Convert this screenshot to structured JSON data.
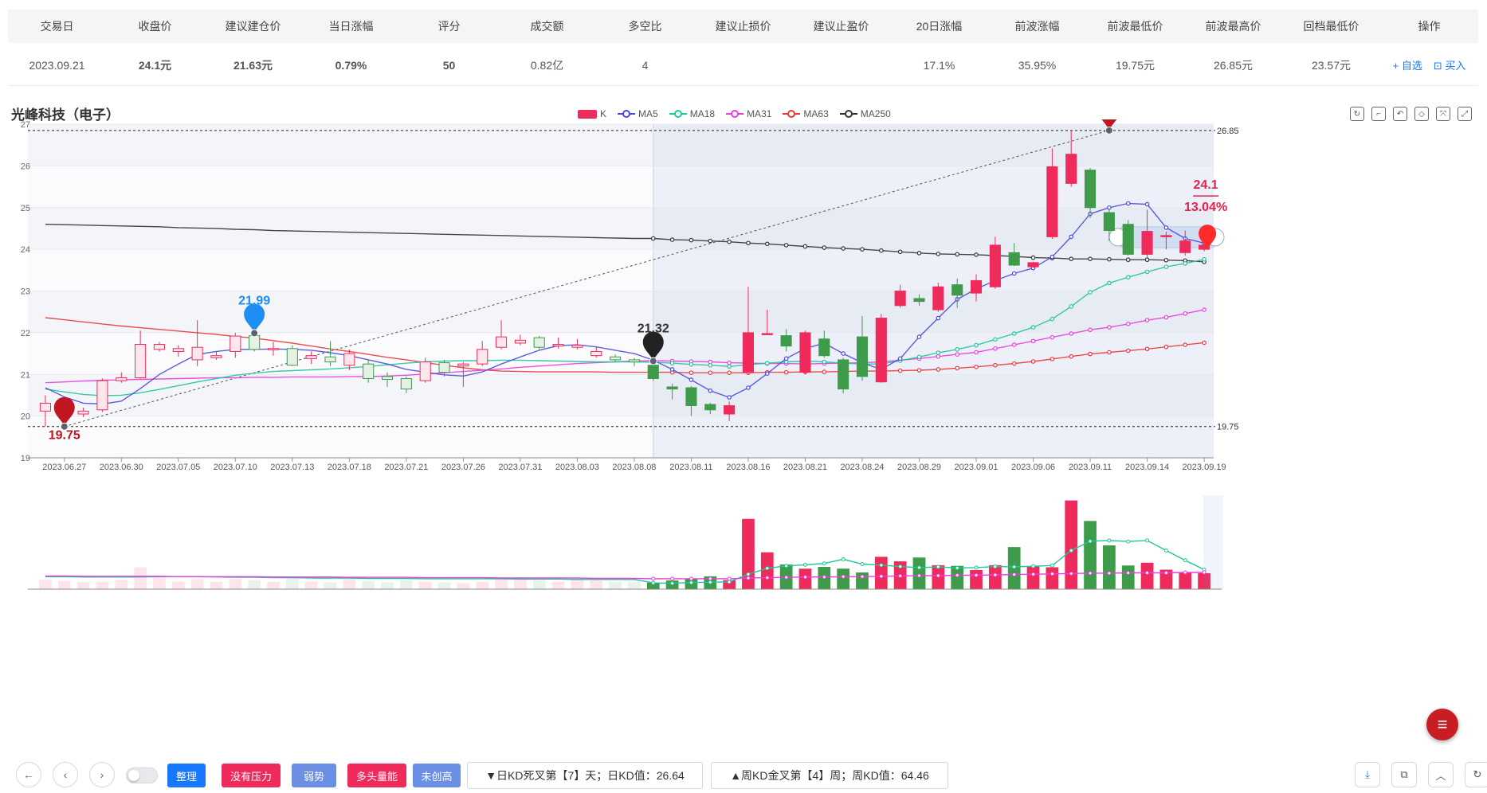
{
  "table": {
    "headers": [
      "交易日",
      "收盘价",
      "建议建仓价",
      "当日涨幅",
      "评分",
      "成交额",
      "多空比",
      "建议止损价",
      "建议止盈价",
      "20日涨幅",
      "前波涨幅",
      "前波最低价",
      "前波最高价",
      "回档最低价",
      "操作"
    ],
    "row": {
      "date": "2023.09.21",
      "close": "24.1元",
      "entry": "21.63元",
      "change": "0.79%",
      "score": "50",
      "turnover": "0.82亿",
      "ratio": "4",
      "stop_loss": "",
      "take_profit": "",
      "chg20": "17.1%",
      "wave_chg": "35.95%",
      "wave_low": "19.75元",
      "wave_high": "26.85元",
      "pullback_low": "23.57元",
      "add_watch": "+ 自选",
      "buy": "⊡ 买入"
    }
  },
  "stock_name": "光峰科技（电子）",
  "legend": [
    "K",
    "MA5",
    "MA18",
    "MA31",
    "MA63",
    "MA250"
  ],
  "colors": {
    "up": "#ef2b5c",
    "down": "#3e9b4a",
    "ma5": "#4b4bd8",
    "ma18": "#1fc79a",
    "ma31": "#ea3ddf",
    "ma63": "#e83a3a",
    "ma250": "#333333"
  },
  "chart_data": {
    "type": "candlestick",
    "ylim": [
      19,
      27
    ],
    "yticks": [
      19,
      20,
      21,
      22,
      23,
      24,
      25,
      26,
      27
    ],
    "xtick_labels": [
      "2023.06.27",
      "2023.06.30",
      "2023.07.05",
      "2023.07.10",
      "2023.07.13",
      "2023.07.18",
      "2023.07.21",
      "2023.07.26",
      "2023.07.31",
      "2023.08.03",
      "2023.08.08",
      "2023.08.11",
      "2023.08.16",
      "2023.08.21",
      "2023.08.24",
      "2023.08.29",
      "2023.09.01",
      "2023.09.06",
      "2023.09.11",
      "2023.09.14",
      "2023.09.19"
    ],
    "zoom_start_index": 32,
    "candles": [
      [
        20.12,
        20.31,
        19.75,
        20.5
      ],
      [
        20.18,
        20.28,
        20.05,
        20.4
      ],
      [
        20.05,
        20.12,
        19.98,
        20.2
      ],
      [
        20.15,
        20.85,
        20.1,
        20.9
      ],
      [
        20.85,
        20.92,
        20.8,
        21.05
      ],
      [
        20.92,
        21.72,
        20.9,
        22.05
      ],
      [
        21.6,
        21.72,
        21.55,
        21.78
      ],
      [
        21.55,
        21.62,
        21.42,
        21.7
      ],
      [
        21.35,
        21.65,
        21.2,
        22.3
      ],
      [
        21.4,
        21.45,
        21.35,
        21.55
      ],
      [
        21.55,
        21.92,
        21.4,
        22.0
      ],
      [
        21.93,
        21.6,
        21.55,
        22.25
      ],
      [
        21.6,
        21.62,
        21.45,
        21.78
      ],
      [
        21.62,
        21.22,
        21.2,
        21.7
      ],
      [
        21.38,
        21.45,
        21.25,
        21.55
      ],
      [
        21.42,
        21.3,
        21.2,
        21.8
      ],
      [
        21.22,
        21.5,
        21.1,
        21.6
      ],
      [
        21.25,
        20.9,
        20.8,
        21.35
      ],
      [
        20.95,
        20.88,
        20.7,
        21.05
      ],
      [
        20.9,
        20.65,
        20.55,
        20.95
      ],
      [
        20.85,
        21.3,
        20.8,
        21.4
      ],
      [
        21.28,
        21.05,
        20.95,
        21.35
      ],
      [
        21.2,
        21.25,
        20.7,
        21.3
      ],
      [
        21.25,
        21.6,
        21.2,
        21.8
      ],
      [
        21.65,
        21.9,
        21.6,
        22.3
      ],
      [
        21.75,
        21.82,
        21.7,
        21.95
      ],
      [
        21.88,
        21.65,
        21.6,
        21.92
      ],
      [
        21.68,
        21.72,
        21.62,
        21.88
      ],
      [
        21.65,
        21.7,
        21.6,
        21.85
      ],
      [
        21.45,
        21.55,
        21.4,
        21.65
      ],
      [
        21.42,
        21.35,
        21.3,
        21.48
      ],
      [
        21.35,
        21.3,
        21.2,
        21.4
      ],
      [
        21.22,
        20.9,
        20.85,
        21.3
      ],
      [
        20.7,
        20.65,
        20.4,
        20.78
      ],
      [
        20.68,
        20.25,
        20.0,
        20.72
      ],
      [
        20.28,
        20.15,
        20.05,
        20.32
      ],
      [
        20.05,
        20.25,
        19.88,
        20.35
      ],
      [
        21.05,
        22.0,
        21.0,
        23.1
      ],
      [
        21.98,
        21.98,
        21.95,
        22.55
      ],
      [
        21.93,
        21.68,
        21.55,
        22.08
      ],
      [
        21.05,
        22.0,
        21.0,
        22.05
      ],
      [
        21.85,
        21.45,
        21.4,
        22.05
      ],
      [
        21.35,
        20.65,
        20.55,
        21.4
      ],
      [
        21.9,
        20.95,
        20.85,
        22.4
      ],
      [
        20.82,
        22.35,
        20.8,
        22.45
      ],
      [
        22.65,
        23.0,
        22.6,
        23.15
      ],
      [
        22.82,
        22.75,
        22.65,
        22.92
      ],
      [
        22.55,
        23.1,
        22.5,
        23.2
      ],
      [
        23.15,
        22.9,
        22.6,
        23.3
      ],
      [
        22.95,
        23.25,
        22.75,
        23.4
      ],
      [
        23.1,
        24.1,
        23.05,
        24.3
      ],
      [
        23.92,
        23.62,
        23.6,
        24.15
      ],
      [
        23.58,
        23.68,
        23.55,
        23.7
      ],
      [
        24.3,
        25.98,
        24.25,
        26.42
      ],
      [
        25.58,
        26.28,
        25.5,
        26.85
      ],
      [
        25.9,
        25.0,
        24.75,
        25.95
      ],
      [
        24.88,
        24.45,
        24.2,
        24.95
      ],
      [
        24.6,
        23.88,
        23.85,
        24.7
      ],
      [
        23.88,
        24.43,
        23.8,
        24.95
      ],
      [
        24.3,
        24.33,
        24.0,
        24.42
      ],
      [
        23.92,
        24.2,
        23.85,
        24.45
      ],
      [
        24.0,
        24.1,
        23.95,
        24.2
      ]
    ],
    "ma": {
      "MA5": [
        20.68,
        20.46,
        20.31,
        20.29,
        20.36,
        20.66,
        21.0,
        21.25,
        21.48,
        21.55,
        21.6,
        21.6,
        21.61,
        21.6,
        21.58,
        21.52,
        21.45,
        21.35,
        21.25,
        21.12,
        21.05,
        20.99,
        20.96,
        21.06,
        21.25,
        21.42,
        21.58,
        21.69,
        21.71,
        21.66,
        21.58,
        21.5,
        21.34,
        21.12,
        20.87,
        20.61,
        20.45,
        20.68,
        21.02,
        21.38,
        21.62,
        21.75,
        21.5,
        21.28,
        21.12,
        21.38,
        21.9,
        22.35,
        22.8,
        23.05,
        23.25,
        23.42,
        23.55,
        23.82,
        24.3,
        24.85,
        25.0,
        25.1,
        25.08,
        24.52,
        24.26,
        24.15
      ],
      "MA18": [
        20.65,
        20.58,
        20.52,
        20.49,
        20.5,
        20.56,
        20.64,
        20.73,
        20.82,
        20.9,
        20.98,
        21.03,
        21.07,
        21.09,
        21.11,
        21.13,
        21.16,
        21.19,
        21.23,
        21.27,
        21.3,
        21.32,
        21.33,
        21.33,
        21.34,
        21.34,
        21.33,
        21.32,
        21.31,
        21.3,
        21.3,
        21.3,
        21.29,
        21.27,
        21.24,
        21.22,
        21.19,
        21.23,
        21.27,
        21.3,
        21.32,
        21.3,
        21.27,
        21.25,
        21.25,
        21.33,
        21.42,
        21.52,
        21.6,
        21.7,
        21.84,
        21.98,
        22.13,
        22.33,
        22.63,
        22.97,
        23.19,
        23.33,
        23.46,
        23.58,
        23.66,
        23.76
      ],
      "MA31": [
        20.8,
        20.82,
        20.84,
        20.86,
        20.87,
        20.88,
        20.89,
        20.9,
        20.91,
        20.92,
        20.92,
        20.93,
        20.93,
        20.94,
        20.94,
        20.94,
        20.95,
        20.95,
        20.96,
        20.98,
        21.01,
        21.04,
        21.07,
        21.1,
        21.13,
        21.17,
        21.2,
        21.23,
        21.26,
        21.28,
        21.3,
        21.32,
        21.33,
        21.32,
        21.31,
        21.3,
        21.28,
        21.27,
        21.26,
        21.26,
        21.25,
        21.26,
        21.27,
        21.28,
        21.3,
        21.34,
        21.38,
        21.43,
        21.48,
        21.53,
        21.62,
        21.71,
        21.8,
        21.89,
        21.98,
        22.07,
        22.13,
        22.21,
        22.3,
        22.37,
        22.46,
        22.55
      ],
      "MA63": [
        22.36,
        22.31,
        22.26,
        22.21,
        22.16,
        22.12,
        22.08,
        22.04,
        22.0,
        21.96,
        21.91,
        21.87,
        21.81,
        21.75,
        21.68,
        21.61,
        21.55,
        21.48,
        21.41,
        21.35,
        21.28,
        21.22,
        21.16,
        21.11,
        21.08,
        21.07,
        21.06,
        21.06,
        21.06,
        21.06,
        21.05,
        21.05,
        21.05,
        21.05,
        21.04,
        21.04,
        21.04,
        21.04,
        21.05,
        21.05,
        21.06,
        21.06,
        21.07,
        21.08,
        21.08,
        21.09,
        21.1,
        21.12,
        21.15,
        21.18,
        21.22,
        21.26,
        21.31,
        21.37,
        21.43,
        21.49,
        21.53,
        21.57,
        21.61,
        21.66,
        21.71,
        21.76
      ],
      "MA250": [
        24.6,
        24.59,
        24.58,
        24.57,
        24.56,
        24.55,
        24.54,
        24.52,
        24.51,
        24.5,
        24.48,
        24.47,
        24.45,
        24.44,
        24.43,
        24.42,
        24.41,
        24.4,
        24.39,
        24.38,
        24.37,
        24.36,
        24.35,
        24.34,
        24.33,
        24.32,
        24.31,
        24.3,
        24.29,
        24.28,
        24.27,
        24.26,
        24.26,
        24.23,
        24.22,
        24.2,
        24.18,
        24.15,
        24.13,
        24.1,
        24.07,
        24.04,
        24.02,
        24.0,
        23.97,
        23.94,
        23.91,
        23.89,
        23.88,
        23.87,
        23.85,
        23.83,
        23.8,
        23.79,
        23.77,
        23.77,
        23.76,
        23.75,
        23.75,
        23.74,
        23.73,
        23.7
      ]
    },
    "volume": [
      0.28,
      0.24,
      0.2,
      0.22,
      0.26,
      0.63,
      0.4,
      0.22,
      0.28,
      0.21,
      0.3,
      0.26,
      0.21,
      0.31,
      0.22,
      0.2,
      0.3,
      0.24,
      0.2,
      0.26,
      0.22,
      0.2,
      0.17,
      0.21,
      0.3,
      0.34,
      0.26,
      0.22,
      0.29,
      0.25,
      0.21,
      0.2,
      0.19,
      0.25,
      0.3,
      0.37,
      0.26,
      2.02,
      1.06,
      0.71,
      0.59,
      0.64,
      0.59,
      0.48,
      0.93,
      0.8,
      0.91,
      0.69,
      0.67,
      0.55,
      0.69,
      1.21,
      0.66,
      0.63,
      2.55,
      1.96,
      1.26,
      0.68,
      0.76,
      0.56,
      0.47,
      0.46
    ],
    "vol_ma": [
      0.36,
      0.36,
      0.35,
      0.35,
      0.35,
      0.35,
      0.36,
      0.36,
      0.36,
      0.35,
      0.34,
      0.34,
      0.33,
      0.33,
      0.32,
      0.32,
      0.32,
      0.31,
      0.31,
      0.31,
      0.3,
      0.3,
      0.3,
      0.3,
      0.3,
      0.29,
      0.29,
      0.29,
      0.28,
      0.28,
      0.28,
      0.28,
      0.18,
      0.17,
      0.19,
      0.2,
      0.21,
      0.43,
      0.6,
      0.67,
      0.7,
      0.74,
      0.86,
      0.72,
      0.69,
      0.65,
      0.62,
      0.64,
      0.61,
      0.62,
      0.65,
      0.64,
      0.66,
      0.68,
      1.11,
      1.38,
      1.4,
      1.37,
      1.4,
      1.11,
      0.83,
      0.56
    ],
    "vol_ma2": [
      0.38,
      0.38,
      0.37,
      0.37,
      0.37,
      0.37,
      0.37,
      0.36,
      0.36,
      0.36,
      0.36,
      0.36,
      0.35,
      0.35,
      0.35,
      0.35,
      0.34,
      0.34,
      0.34,
      0.34,
      0.33,
      0.33,
      0.33,
      0.33,
      0.32,
      0.32,
      0.32,
      0.32,
      0.32,
      0.31,
      0.31,
      0.31,
      0.3,
      0.3,
      0.3,
      0.3,
      0.3,
      0.32,
      0.33,
      0.34,
      0.35,
      0.35,
      0.36,
      0.36,
      0.37,
      0.38,
      0.39,
      0.39,
      0.4,
      0.4,
      0.41,
      0.42,
      0.43,
      0.44,
      0.45,
      0.46,
      0.46,
      0.47,
      0.47,
      0.47,
      0.48,
      0.48
    ],
    "markers": {
      "low": {
        "index": 1,
        "value": "19.75"
      },
      "mid1": {
        "index": 11,
        "value": "21.99"
      },
      "mid2": {
        "index": 32,
        "value": "21.32"
      },
      "high": {
        "index": 56,
        "value": "26.85"
      },
      "last": {
        "index": 61,
        "value": "24.1",
        "pct": "13.04%"
      }
    },
    "ref_lines": [
      {
        "value": 26.85,
        "label": "26.85"
      },
      {
        "value": 19.75,
        "label": "19.75"
      }
    ]
  },
  "bottom": {
    "tags": [
      "整理",
      "没有压力",
      "弱势",
      "多头量能",
      "未创高"
    ],
    "info1": "▼日KD死叉第【7】天；日KD值：26.64",
    "info2": "▲周KD金叉第【4】周；周KD值：64.46",
    "menu_icon": "≡"
  }
}
